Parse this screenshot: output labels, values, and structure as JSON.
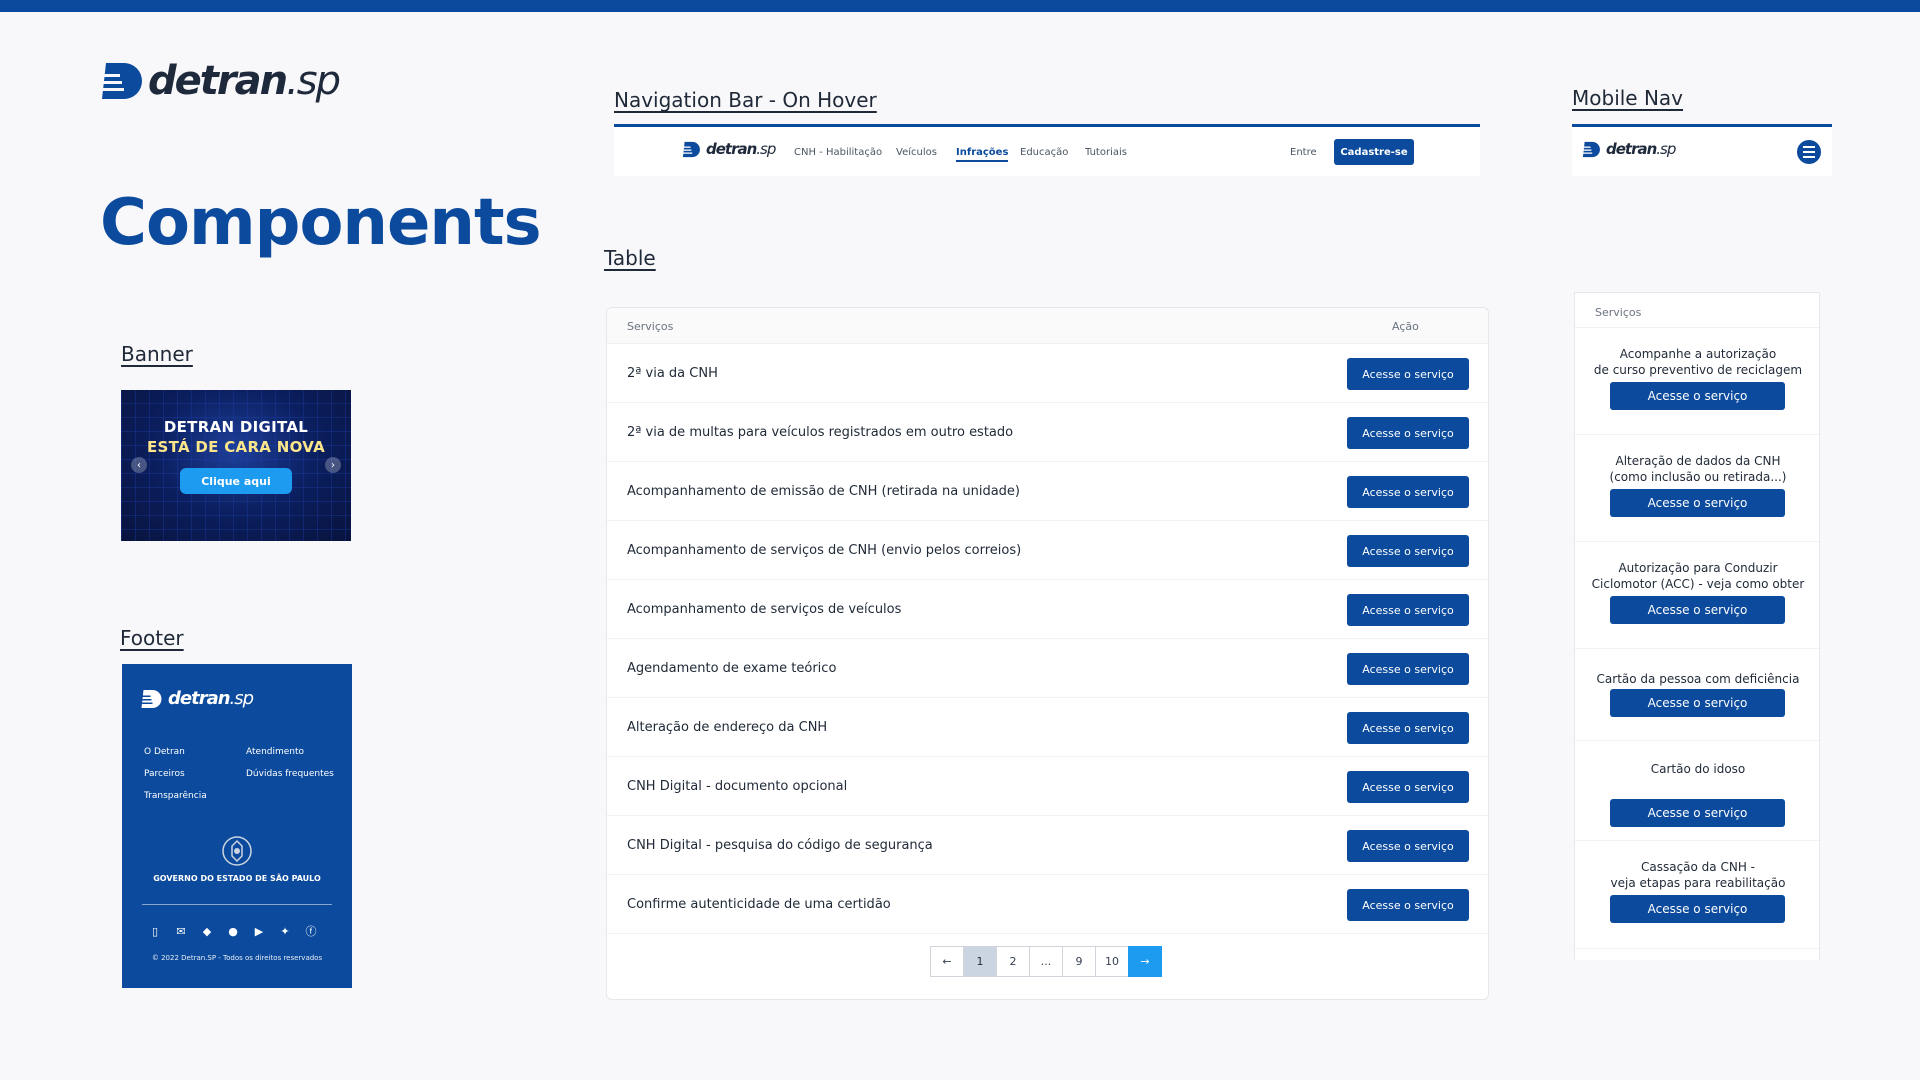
{
  "brand": {
    "name": "detran",
    "suffix": ".sp",
    "primary": "#0b4a9c",
    "accent": "#1d9bf0"
  },
  "page": {
    "title": "Components"
  },
  "sections": {
    "banner": "Banner",
    "footer": "Footer",
    "navbar": "Navigation Bar - On Hover",
    "mobile_nav": "Mobile Nav",
    "table": "Table"
  },
  "banner": {
    "line1": "DETRAN DIGITAL",
    "line2": "ESTÁ DE CARA NOVA",
    "button": "Clique aqui",
    "prev_icon": "chevron-left-icon",
    "next_icon": "chevron-right-icon"
  },
  "footer": {
    "links": [
      "O Detran",
      "Atendimento",
      "Parceiros",
      "Dúvidas frequentes",
      "Transparência"
    ],
    "gov": "GOVERNO DO ESTADO DE SÃO PAULO",
    "social": [
      "phone-icon",
      "mail-icon",
      "diamond-icon",
      "chat-icon",
      "youtube-icon",
      "twitter-icon",
      "facebook-icon"
    ],
    "copyright": "© 2022 Detran.SP - Todos os direitos reservados"
  },
  "navbar": {
    "items": [
      "CNH - Habilitação",
      "Veículos",
      "Infrações",
      "Educação",
      "Tutoriais"
    ],
    "active": "Infrações",
    "login": "Entre",
    "signup": "Cadastre-se"
  },
  "table": {
    "headers": [
      "Serviços",
      "Ação"
    ],
    "action_label": "Acesse o serviço",
    "rows": [
      "2ª via da CNH",
      "2ª via de multas para veículos registrados em outro estado",
      "Acompanhamento de emissão de CNH (retirada na unidade)",
      "Acompanhamento de serviços de CNH (envio pelos correios)",
      "Acompanhamento de serviços de veículos",
      "Agendamento de exame teórico",
      "Alteração de endereço da CNH",
      "CNH Digital - documento opcional",
      "CNH Digital - pesquisa do código de segurança",
      "Confirme autenticidade de uma certidão"
    ],
    "pagination": [
      "←",
      "1",
      "2",
      "...",
      "9",
      "10",
      "→"
    ],
    "current_page": "1"
  },
  "mobile_table": {
    "header": "Serviços",
    "action_label": "Acesse o serviço",
    "rows": [
      [
        "Acompanhe a autorização",
        "de curso preventivo de reciclagem"
      ],
      [
        "Alteração de dados da CNH",
        "(como inclusão ou retirada...)"
      ],
      [
        "Autorização para Conduzir",
        "Ciclomotor (ACC) - veja como obter"
      ],
      [
        "Cartão da pessoa com deficiência"
      ],
      [
        "Cartão do idoso"
      ],
      [
        "Cassação da CNH -",
        "veja etapas para reabilitação"
      ]
    ]
  }
}
